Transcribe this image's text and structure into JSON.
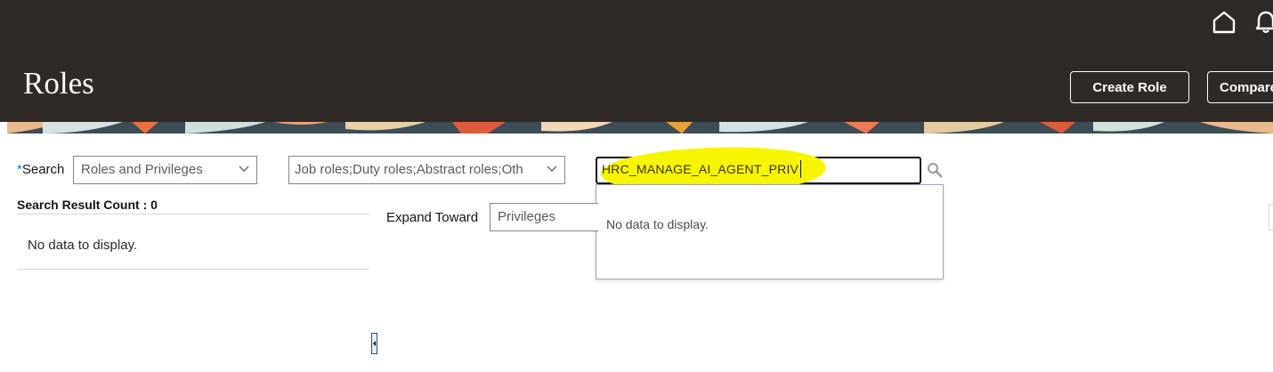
{
  "header": {
    "title": "Roles",
    "create_role_label": "Create Role",
    "compare_label": "Compare",
    "icons": [
      "home-icon",
      "bell-icon"
    ],
    "bg_color": "#302a26"
  },
  "search": {
    "required_mark": "*",
    "label": "Search",
    "type_select": "Roles and Privileges",
    "role_types_select": "Job roles;Duty roles;Abstract roles;Oth",
    "query": "HRC_MANAGE_AI_AGENT_PRIV",
    "highlight_color": "#f7f600",
    "dropdown_message": "No data to display."
  },
  "results": {
    "count_label": "Search Result Count : 0",
    "empty_message": "No data to display."
  },
  "expand": {
    "label": "Expand Toward",
    "value": "Privileges"
  }
}
